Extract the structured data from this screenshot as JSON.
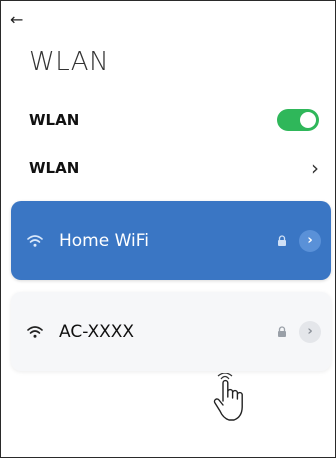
{
  "header": {
    "back_icon": "arrow-left-icon",
    "back_glyph": "←",
    "title": "WLAN"
  },
  "wlan_toggle": {
    "label": "WLAN",
    "enabled": true,
    "accent": "#2fb75a"
  },
  "wlan_link": {
    "label": "WLAN",
    "chevron": "›"
  },
  "networks": [
    {
      "name": "Home WiFi",
      "connected": true,
      "secured": true,
      "info_glyph": "›",
      "accent": "#3a76c4"
    },
    {
      "name": "AC-XXXX",
      "connected": false,
      "secured": true,
      "info_glyph": "›"
    }
  ],
  "cursor": {
    "icon": "hand-pointer-icon"
  }
}
